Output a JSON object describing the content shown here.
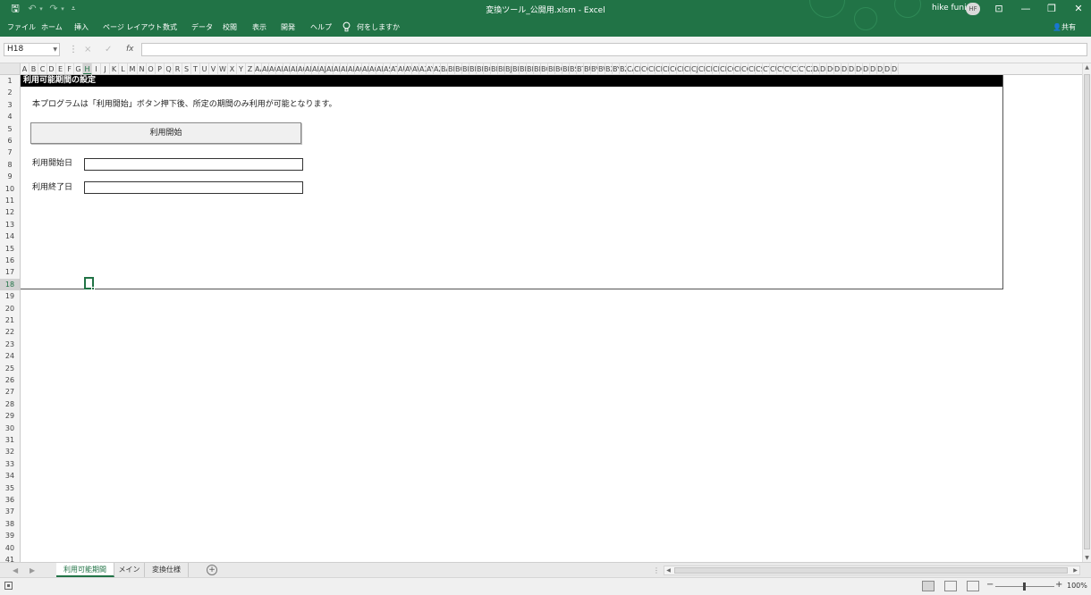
{
  "titlebar": {
    "quick_access": [
      "🖫",
      "↶",
      "▾",
      "↷",
      "▾",
      "⩡"
    ],
    "window_title": "変換ツール_公開用.xlsm  -  Excel",
    "user_name": "hike funi",
    "user_initials": "HF",
    "window_controls": [
      "⊡",
      "—",
      "❐",
      "✕"
    ]
  },
  "ribbon": {
    "tabs": [
      "ファイル",
      "ホーム",
      "挿入",
      "ページ レイアウト",
      "数式",
      "データ",
      "校閲",
      "表示",
      "開発",
      "ヘルプ",
      "何をしますか"
    ],
    "tell_me_icon": "lightbulb-icon",
    "share_label": "共有"
  },
  "formula_bar": {
    "name_box": "H18",
    "cancel_icon": "×",
    "enter_icon": "✓",
    "fx_label": "fx",
    "formula_value": ""
  },
  "grid": {
    "columns": [
      "A",
      "B",
      "C",
      "D",
      "E",
      "F",
      "G",
      "H",
      "I",
      "J",
      "K",
      "L",
      "M",
      "N",
      "O",
      "P",
      "Q",
      "R",
      "S",
      "T",
      "U",
      "V",
      "W",
      "X",
      "Y",
      "Z",
      "AA",
      "AB",
      "AC",
      "AD",
      "AE",
      "AF",
      "AG",
      "AH",
      "AI",
      "AJ",
      "AK",
      "AL",
      "AM",
      "AN",
      "AO",
      "AP",
      "AQ",
      "AR",
      "AS",
      "AT",
      "AU",
      "AV",
      "AW",
      "AX",
      "AY",
      "AZ",
      "BA",
      "BB",
      "BC",
      "BD",
      "BE",
      "BF",
      "BG",
      "BH",
      "BI",
      "BJ",
      "BK",
      "BL",
      "BM",
      "BN",
      "BO",
      "BP",
      "BQ",
      "BR",
      "BS",
      "BT",
      "BU",
      "BV",
      "BW",
      "BX",
      "BY",
      "BZ",
      "CA",
      "CB",
      "CC",
      "CD",
      "CE",
      "CF",
      "CG",
      "CH",
      "CI",
      "CJ",
      "CK",
      "CL",
      "CM",
      "CN",
      "CO",
      "CP",
      "CQ",
      "CR",
      "CS",
      "CT",
      "CU",
      "CV",
      "CW",
      "CX",
      "CY",
      "CZ",
      "DA",
      "DB",
      "DC",
      "DD",
      "DE",
      "DF",
      "DG",
      "DH",
      "DI",
      "DJ",
      "DK",
      "DL"
    ],
    "selected_column": "H",
    "row_count": 41,
    "selected_row": 18,
    "active_cell": "H18"
  },
  "sheet": {
    "heading": "利用可能期間の設定",
    "description": "本プログラムは「利用開始」ボタン押下後、所定の期間のみ利用が可能となります。",
    "start_button_label": "利用開始",
    "start_date_label": "利用開始日",
    "start_date_value": "",
    "end_date_label": "利用終了日",
    "end_date_value": ""
  },
  "sheet_tabs": {
    "tabs": [
      "利用可能期間",
      "メイン",
      "変換仕様"
    ],
    "active_index": 0,
    "add_label": "+",
    "prev_icon": "◀",
    "next_icon": "▶"
  },
  "status_bar": {
    "zoom_label": "100%",
    "zoom_minus": "−",
    "zoom_plus": "+",
    "zoom_fraction": 0.5
  },
  "colors": {
    "excel_green": "#217346",
    "heading_bg": "#000000"
  }
}
